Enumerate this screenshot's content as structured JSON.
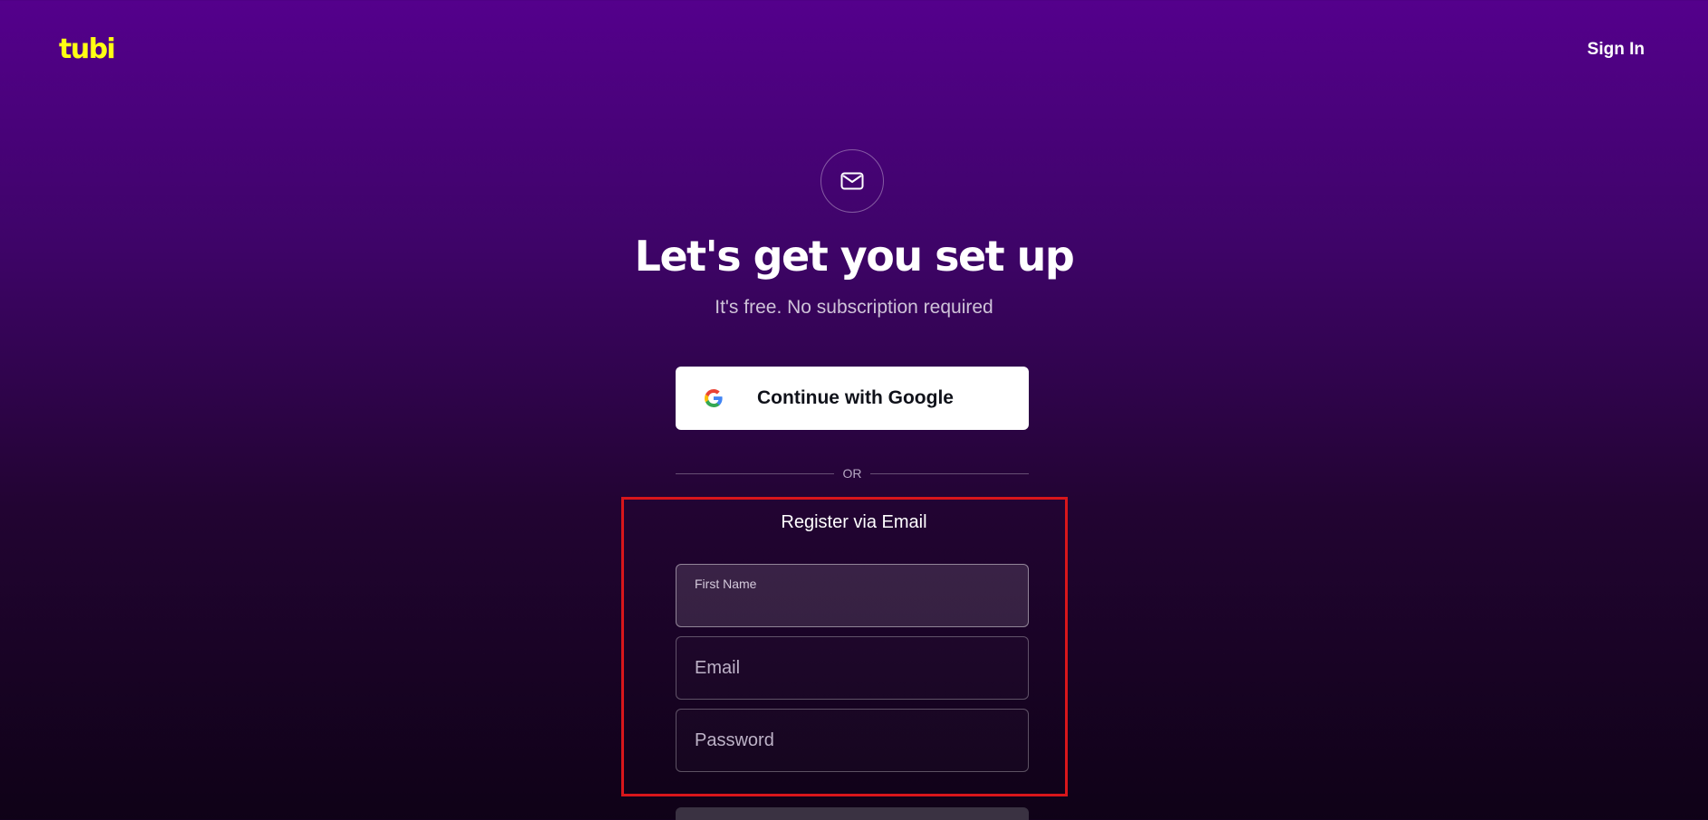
{
  "header": {
    "logo_text": "tubi",
    "signin_label": "Sign In"
  },
  "hero": {
    "icon": "mail-icon",
    "title": "Let's get you set up",
    "subtitle": "It's free. No subscription required"
  },
  "google": {
    "icon": "google-icon",
    "label": "Continue with Google"
  },
  "divider": {
    "text": "OR"
  },
  "register": {
    "heading": "Register via Email",
    "first_name_label": "First Name",
    "email_placeholder": "Email",
    "password_placeholder": "Password"
  },
  "colors": {
    "logo": "#ffff13",
    "highlight": "#d8161b",
    "bg_top": "#54008c",
    "bg_bottom": "#0f0217"
  }
}
